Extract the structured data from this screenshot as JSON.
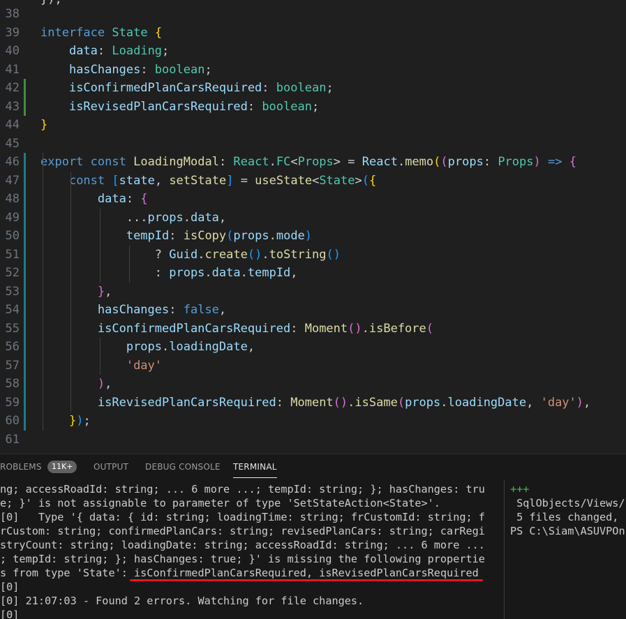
{
  "editor": {
    "lines": [
      {
        "n": "38",
        "html": ""
      },
      {
        "n": "39",
        "html": "<span class=\"kw\">interface</span> <span class=\"type\">State</span> <span class=\"b1\">{</span>"
      },
      {
        "n": "40",
        "html": "    <span class=\"prop\">data</span>: <span class=\"type\">Loading</span>;"
      },
      {
        "n": "41",
        "html": "    <span class=\"prop\">hasChanges</span>: <span class=\"type\">boolean</span>;"
      },
      {
        "n": "42",
        "html": "    <span class=\"prop\">isConfirmedPlanCarsRequired</span>: <span class=\"type\">boolean</span>;"
      },
      {
        "n": "43",
        "html": "    <span class=\"prop\">isRevisedPlanCarsRequired</span>: <span class=\"type\">boolean</span>;"
      },
      {
        "n": "44",
        "html": "<span class=\"b1\">}</span>"
      },
      {
        "n": "45",
        "html": ""
      },
      {
        "n": "46",
        "html": "<span class=\"kw\">export</span> <span class=\"kw\">const</span> <span class=\"fn\">LoadingModal</span>: <span class=\"type\">React</span>.<span class=\"type\">FC</span><span class=\"op\">&lt;</span><span class=\"type\">Props</span><span class=\"op\">&gt;</span> = <span class=\"prop\">React</span>.<span class=\"fn\">memo</span><span class=\"b1\">(</span><span class=\"b2\">(</span><span class=\"prop\">props</span>: <span class=\"type\">Props</span><span class=\"b2\">)</span> <span class=\"kw\">=&gt;</span> <span class=\"b2\">{</span>"
      },
      {
        "n": "47",
        "html": "    <span class=\"kw\">const</span> <span class=\"b3\">[</span><span class=\"prop\">state</span>, <span class=\"fn\">setState</span><span class=\"b3\">]</span> = <span class=\"fn\">useState</span><span class=\"op\">&lt;</span><span class=\"type\">State</span><span class=\"op\">&gt;</span><span class=\"b3\">(</span><span class=\"b1\">{</span>"
      },
      {
        "n": "48",
        "html": "        <span class=\"prop\">data</span>: <span class=\"b2\">{</span>"
      },
      {
        "n": "49",
        "html": "            ...<span class=\"prop\">props</span>.<span class=\"prop\">data</span>,"
      },
      {
        "n": "50",
        "html": "            <span class=\"prop\">tempId</span>: <span class=\"fn\">isCopy</span><span class=\"b3\">(</span><span class=\"prop\">props</span>.<span class=\"prop\">mode</span><span class=\"b3\">)</span>"
      },
      {
        "n": "51",
        "html": "                ? <span class=\"prop\">Guid</span>.<span class=\"fn\">create</span><span class=\"b3\">()</span>.<span class=\"fn\">toString</span><span class=\"b3\">()</span>"
      },
      {
        "n": "52",
        "html": "                : <span class=\"prop\">props</span>.<span class=\"prop\">data</span>.<span class=\"prop\">tempId</span>,"
      },
      {
        "n": "53",
        "html": "        <span class=\"b2\">}</span>,"
      },
      {
        "n": "54",
        "html": "        <span class=\"prop\">hasChanges</span>: <span class=\"kw\">false</span>,"
      },
      {
        "n": "55",
        "html": "        <span class=\"prop\">isConfirmedPlanCarsRequired</span>: <span class=\"fn\">Moment</span><span class=\"b2\">()</span>.<span class=\"fn\">isBefore</span><span class=\"b2\">(</span>"
      },
      {
        "n": "56",
        "html": "            <span class=\"prop\">props</span>.<span class=\"prop\">loadingDate</span>,"
      },
      {
        "n": "57",
        "html": "            <span class=\"str\">'day'</span>"
      },
      {
        "n": "58",
        "html": "        <span class=\"b2\">)</span>,"
      },
      {
        "n": "59",
        "html": "        <span class=\"prop\">isRevisedPlanCarsRequired</span>: <span class=\"fn\">Moment</span><span class=\"b2\">()</span>.<span class=\"fn\">isSame</span><span class=\"b2\">(</span><span class=\"prop\">props</span>.<span class=\"prop\">loadingDate</span>, <span class=\"str\">'day'</span><span class=\"b2\">)</span>,"
      },
      {
        "n": "60",
        "html": "    <span class=\"b1\">}</span><span class=\"b3\">)</span>;"
      },
      {
        "n": "61",
        "html": ""
      }
    ],
    "top_fragment": "});"
  },
  "panel": {
    "tabs": [
      {
        "label": "ROBLEMS"
      },
      {
        "label": "11K+"
      },
      {
        "label": "OUTPUT"
      },
      {
        "label": "DEBUG CONSOLE"
      },
      {
        "label": "TERMINAL"
      }
    ],
    "terminal_left": [
      "ng; accessRoadId: string; ... 6 more ...; tempId: string; }; hasChanges: tru",
      "e; }' is not assignable to parameter of type 'SetStateAction<State>'.",
      "[0]   Type '{ data: { id: string; loadingTime: string; frCustomId: string; f",
      "rCustom: string; confirmedPlanCars: string; revisedPlanCars: string; carRegi",
      "stryCount: string; loadingDate: string; accessRoadId: string; ... 6 more ...",
      "; tempId: string; }; hasChanges: true; }' is missing the following propertie",
      "s from type 'State': isConfirmedPlanCarsRequired, isRevisedPlanCarsRequired",
      "[0]",
      "[0] 21:07:03 - Found 2 errors. Watching for file changes.",
      "[0]"
    ],
    "terminal_right": [
      "+++",
      " SqlObjects/Views/",
      " 5 files changed, ",
      "PS C:\\Siam\\ASUVPOn"
    ]
  },
  "colors": {
    "accent_green": "#3e8e41",
    "accent_blue": "#1f7a8c",
    "error_underline": "#e81123"
  }
}
